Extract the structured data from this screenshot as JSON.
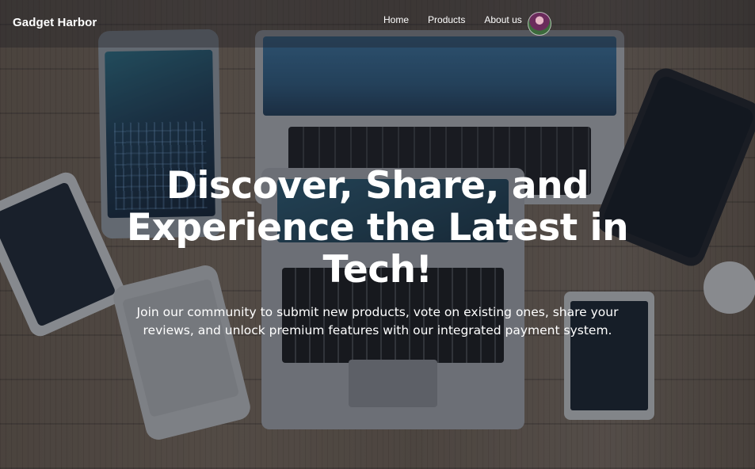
{
  "navbar": {
    "brand": "Gadget Harbor",
    "links": [
      {
        "label": "Home"
      },
      {
        "label": "Products"
      },
      {
        "label": "About us"
      }
    ]
  },
  "hero": {
    "title": "Discover, Share, and Experience the Latest in Tech!",
    "subtitle": "Join our community to submit new products, vote on existing ones, share your reviews, and unlock premium features with our integrated payment system."
  },
  "icons": {
    "avatar": "user-avatar"
  },
  "colors": {
    "text": "#ffffff",
    "overlay": "#181a22"
  }
}
